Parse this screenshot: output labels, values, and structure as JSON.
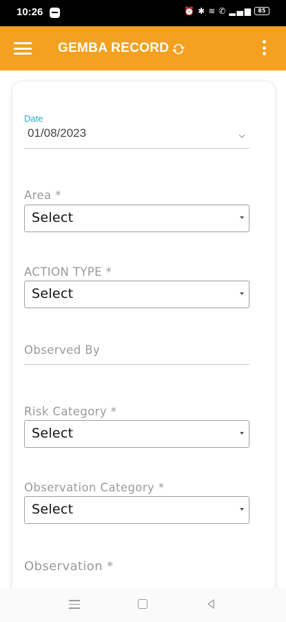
{
  "status_bar": {
    "time": "10:26",
    "icons": [
      "alarm-icon",
      "bluetooth-icon",
      "wifi-icon",
      "call-icon",
      "signal-icon",
      "battery-icon"
    ],
    "battery_level": "85"
  },
  "app_bar": {
    "title": "GEMBA RECORD",
    "background_color": "#F4A020"
  },
  "form": {
    "date": {
      "label": "Date",
      "value": "01/08/2023"
    },
    "area": {
      "label": "Area *",
      "selected": "Select"
    },
    "action_type": {
      "label": "ACTION TYPE *",
      "selected": "Select"
    },
    "observed_by": {
      "placeholder": "Observed By"
    },
    "risk_category": {
      "label": "Risk Category *",
      "selected": "Select"
    },
    "observation_category": {
      "label": "Observation Category *",
      "selected": "Select"
    },
    "observation": {
      "label": "Observation *"
    }
  },
  "colors": {
    "accent": "#2BA7C8",
    "label": "#9a9a9a"
  },
  "nav_bar": {
    "icons": [
      "recents-icon",
      "home-icon",
      "back-icon"
    ]
  }
}
